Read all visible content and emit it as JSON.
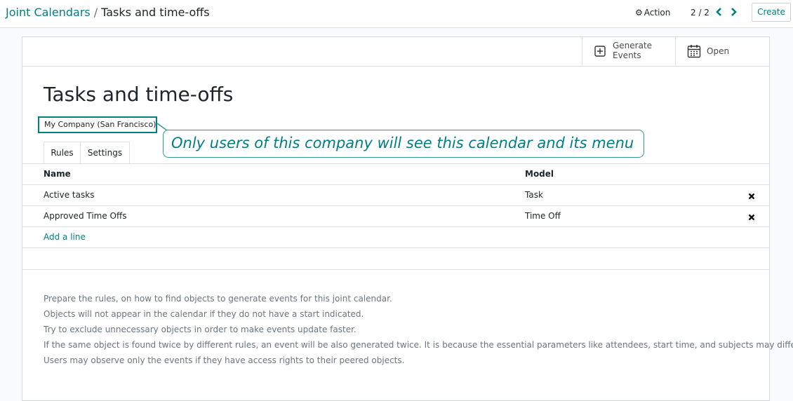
{
  "breadcrumb": {
    "parent": "Joint Calendars",
    "separator": "/",
    "current": "Tasks and time-offs"
  },
  "toolbar": {
    "action_label": "Action",
    "pager": "2 / 2",
    "create_label": "Create"
  },
  "stat_buttons": {
    "generate_label_1": "Generate",
    "generate_label_2": "Events",
    "open_label": "Open"
  },
  "record": {
    "title": "Tasks and time-offs",
    "company": "My Company (San Francisco)",
    "callout": "Only users of this company will see this calendar and its menu"
  },
  "tabs": [
    {
      "label": "Rules",
      "active": true
    },
    {
      "label": "Settings",
      "active": false
    }
  ],
  "rules_table": {
    "columns": [
      "Name",
      "Model"
    ],
    "rows": [
      {
        "name": "Active tasks",
        "model": "Task"
      },
      {
        "name": "Approved Time Offs",
        "model": "Time Off"
      }
    ],
    "add_line_label": "Add a line"
  },
  "help_text": [
    "Prepare the rules, on how to find objects to generate events for this joint calendar.",
    "Objects will not appear in the calendar if they do not have a start indicated.",
    "Try to exclude unnecessary objects in order to make events update faster.",
    "If the same object is found twice by different rules, an event will be also generated twice. It is because the essential parameters like attendees, start time, and subjects may differ.",
    "Users may observe only the events if they have access rights to their peered objects."
  ],
  "colors": {
    "accent": "#017e84",
    "callout_border": "#2e9e80",
    "text": "#212529",
    "muted": "#6c757d"
  }
}
